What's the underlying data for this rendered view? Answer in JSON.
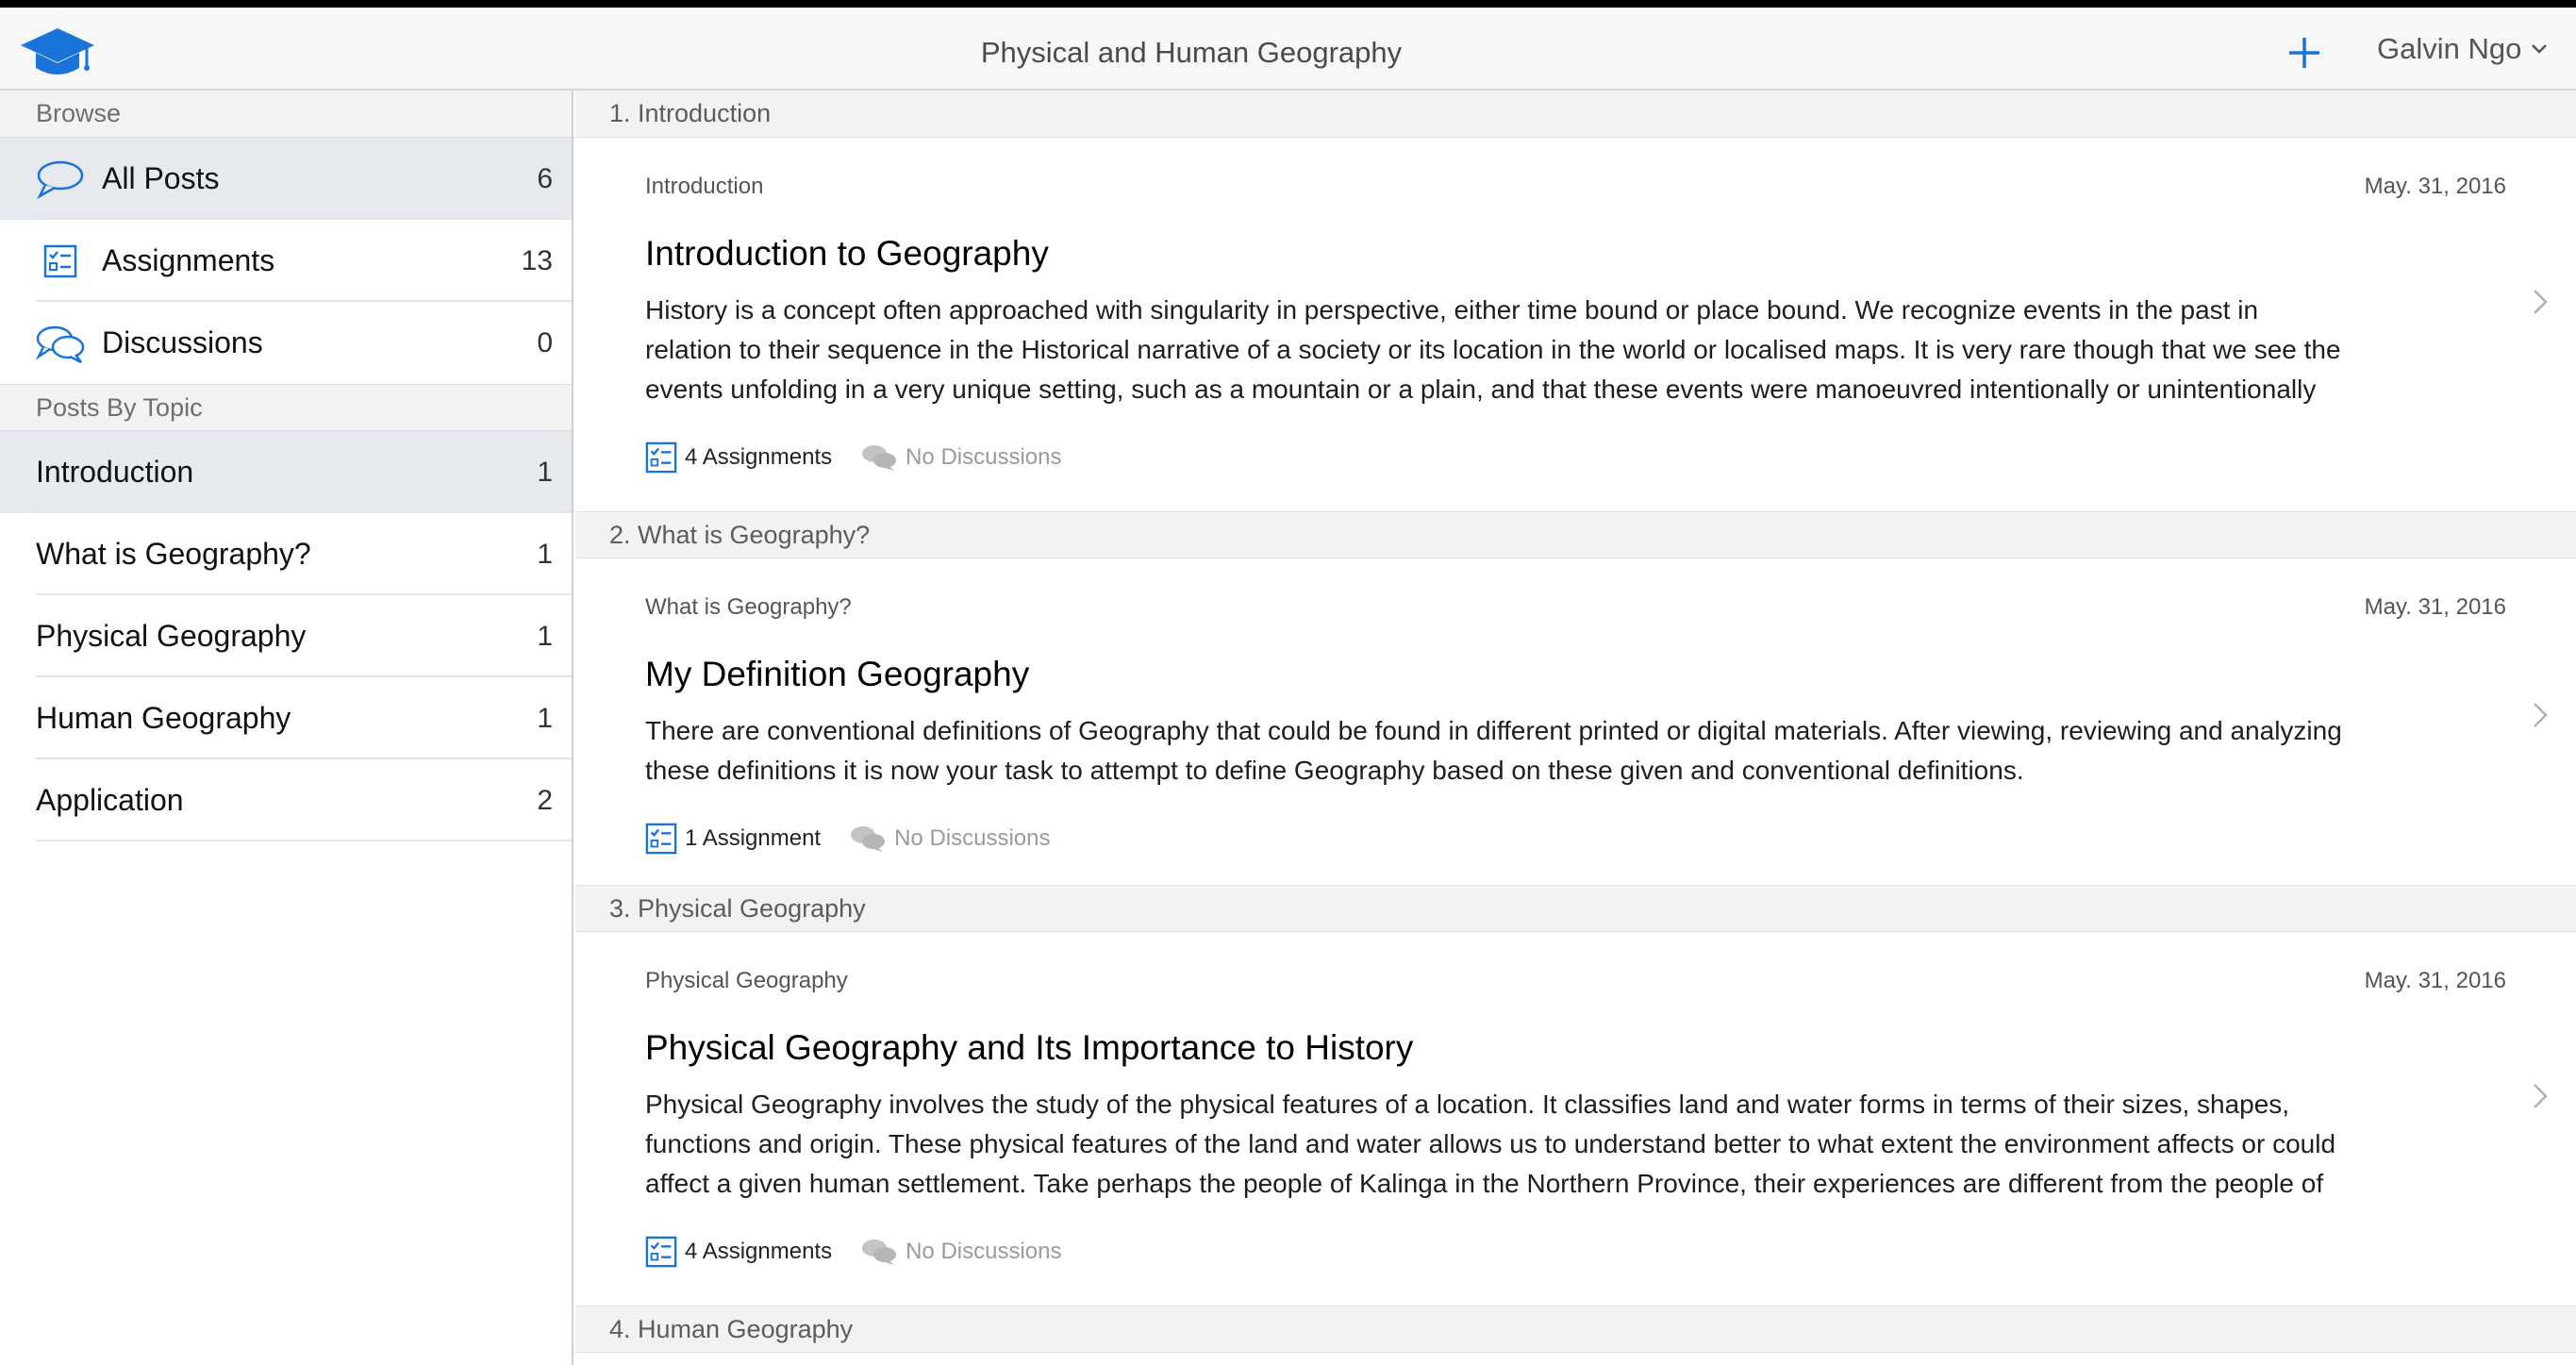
{
  "header": {
    "title": "Physical and Human Geography",
    "user_name": "Galvin Ngo",
    "add_icon": "plus-icon",
    "logo_icon": "graduation-cap-icon"
  },
  "colors": {
    "accent": "#1a73d9",
    "selected_row": "#e6e9ee",
    "section_bg": "#f2f2f2"
  },
  "sidebar": {
    "browse_header": "Browse",
    "browse_items": [
      {
        "label": "All Posts",
        "count": "6",
        "icon": "speech-bubble-icon",
        "selected": true
      },
      {
        "label": "Assignments",
        "count": "13",
        "icon": "checklist-icon",
        "selected": false
      },
      {
        "label": "Discussions",
        "count": "0",
        "icon": "discussion-bubbles-icon",
        "selected": false
      }
    ],
    "topics_header": "Posts By Topic",
    "topics": [
      {
        "label": "Introduction",
        "count": "1",
        "selected": true
      },
      {
        "label": "What is Geography?",
        "count": "1",
        "selected": false
      },
      {
        "label": "Physical Geography",
        "count": "1",
        "selected": false
      },
      {
        "label": "Human Geography",
        "count": "1",
        "selected": false
      },
      {
        "label": "Application",
        "count": "2",
        "selected": false
      }
    ]
  },
  "main": {
    "sections": [
      {
        "header": "1. Introduction",
        "post": {
          "topic": "Introduction",
          "date": "May. 31, 2016",
          "title": "Introduction to Geography",
          "lines": [
            "History is a concept often approached with singularity in perspective, either time bound or place bound. We recognize events in the past in",
            "relation to their sequence in the Historical narrative of a society or its location in the world or localised maps. It is very rare though that we see the",
            "events unfolding in a very unique setting, such as a mountain or a plain, and that these events were manoeuvred intentionally or unintentionally"
          ],
          "assignments": "4 Assignments",
          "discussions": "No Discussions"
        }
      },
      {
        "header": "2. What is Geography?",
        "post": {
          "topic": "What is Geography?",
          "date": "May. 31, 2016",
          "title": "My Definition Geography",
          "lines": [
            "There are conventional definitions of Geography that could be found in different printed or digital materials. After viewing, reviewing and analyzing",
            "these definitions it is now your task to attempt to define Geography based on these given and conventional definitions."
          ],
          "assignments": "1 Assignment",
          "discussions": "No Discussions"
        }
      },
      {
        "header": "3. Physical Geography",
        "post": {
          "topic": "Physical Geography",
          "date": "May. 31, 2016",
          "title": "Physical Geography and Its Importance to History",
          "lines": [
            "Physical Geography involves the study of the physical features of a location. It classifies land and water forms in terms of their sizes, shapes,",
            "functions and origin. These physical features of the land and water allows us to understand better to what extent the environment affects or could",
            "affect a given human settlement. Take perhaps the people of Kalinga in the Northern Province, their experiences are different from the people of"
          ],
          "assignments": "4 Assignments",
          "discussions": "No Discussions"
        }
      },
      {
        "header": "4. Human Geography"
      }
    ]
  }
}
